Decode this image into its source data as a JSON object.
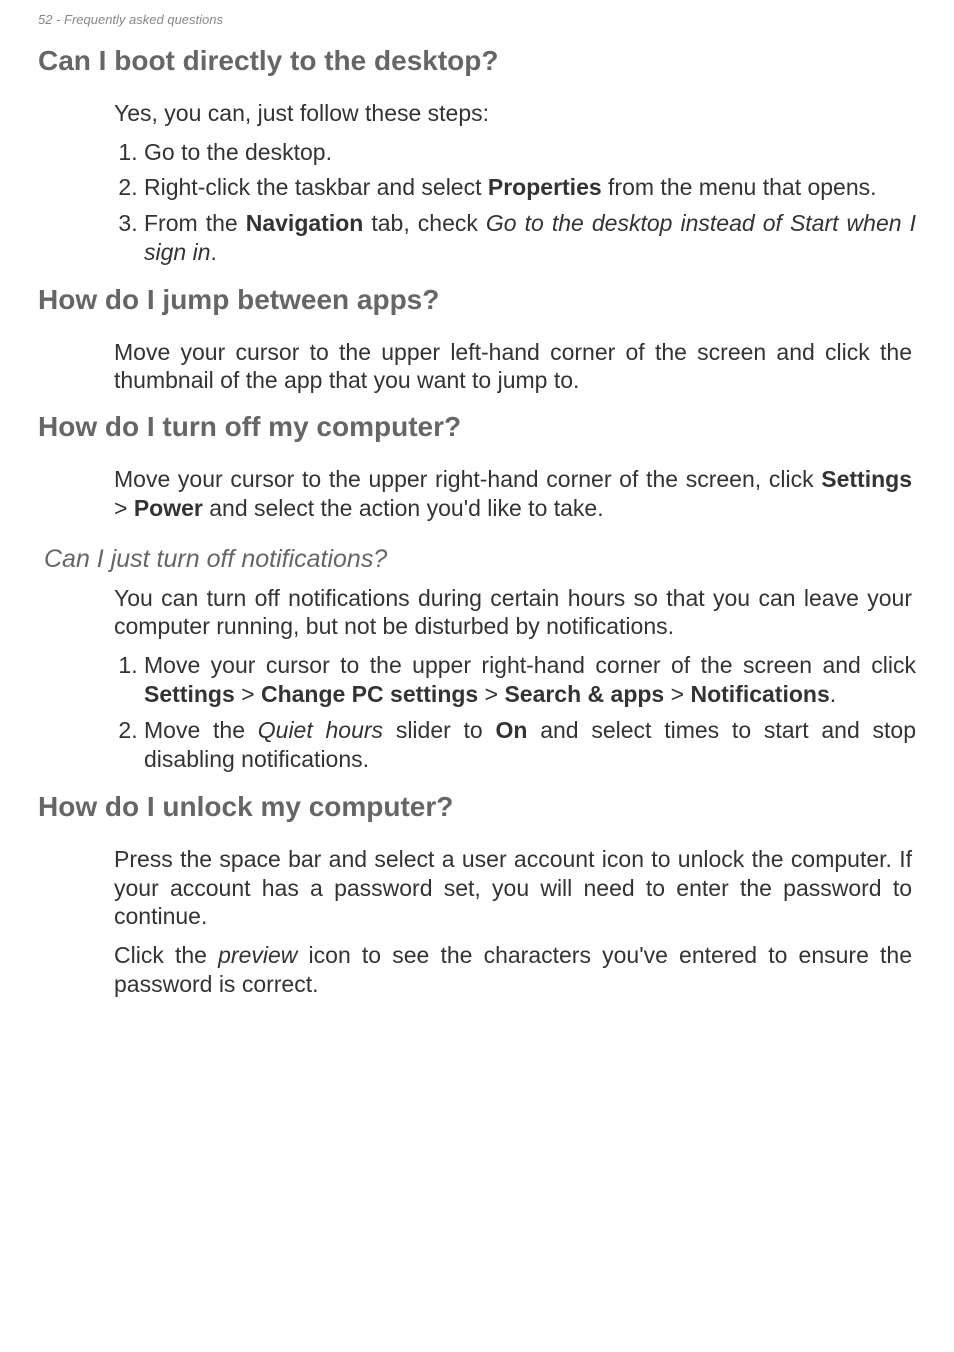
{
  "header": "52 - Frequently asked questions",
  "s1": {
    "title": "Can I boot directly to the desktop?",
    "intro": "Yes, you can, just follow these steps:",
    "i1": "Go to the desktop.",
    "i2a": "Right-click the taskbar and select ",
    "i2b": "Properties",
    "i2c": " from the menu that opens.",
    "i3a": "From the ",
    "i3b": "Navigation",
    "i3c": " tab, check ",
    "i3d": "Go to the desktop instead of Start when I sign in",
    "i3e": "."
  },
  "s2": {
    "title": "How do I jump between apps?",
    "p": "Move your cursor to the upper left-hand corner of the screen and click the thumbnail of the app that you want to jump to."
  },
  "s3": {
    "title": "How do I turn off my computer?",
    "p1a": "Move your cursor to the upper right-hand corner of the screen, click ",
    "p1b": "Settings",
    "p1c": " > ",
    "p1d": "Power",
    "p1e": " and select the action you'd like to take.",
    "sub": "Can I just turn off notifications?",
    "sp": "You can turn off notifications during certain hours so that you can leave your computer running, but not be disturbed by notifications.",
    "si1a": "Move your cursor to the upper right-hand corner of the screen and click ",
    "si1b": "Settings",
    "si1c": " > ",
    "si1d": "Change PC settings",
    "si1e": " > ",
    "si1f": "Search & apps",
    "si1g": " > ",
    "si1h": "Notifications",
    "si1i": ".",
    "si2a": "Move the ",
    "si2b": "Quiet hours",
    "si2c": " slider to ",
    "si2d": "On",
    "si2e": " and select times to start and stop disabling notifications."
  },
  "s4": {
    "title": "How do I unlock my computer?",
    "p1": "Press the space bar and select a user account icon to unlock the computer. If your account has a password set, you will need to enter the password to continue.",
    "p2a": "Click the ",
    "p2b": "preview",
    "p2c": " icon to see the characters you've entered to ensure the password is correct."
  }
}
